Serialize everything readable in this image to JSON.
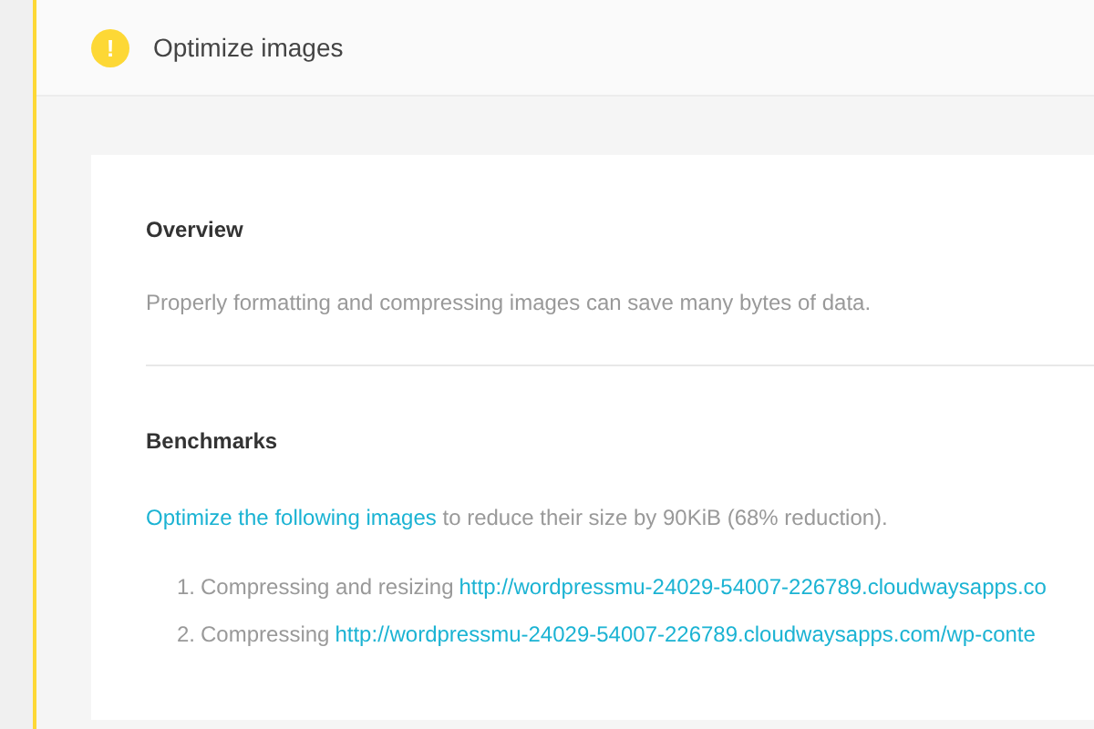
{
  "audit": {
    "warning": true,
    "icon": "!",
    "title": "Optimize images"
  },
  "overview": {
    "heading": "Overview",
    "text": "Properly formatting and compressing images can save many bytes of data."
  },
  "benchmarks": {
    "heading": "Benchmarks",
    "link": "Optimize the following images",
    "text": " to reduce their size by 90KiB (68% reduction).",
    "items": [
      {
        "number": "1.",
        "action": "Compressing and resizing",
        "url": "http://wordpressmu-24029-54007-226789.cloudwaysapps.co"
      },
      {
        "number": "2.",
        "action": "Compressing",
        "url": "http://wordpressmu-24029-54007-226789.cloudwaysapps.com/wp-conte"
      }
    ]
  }
}
